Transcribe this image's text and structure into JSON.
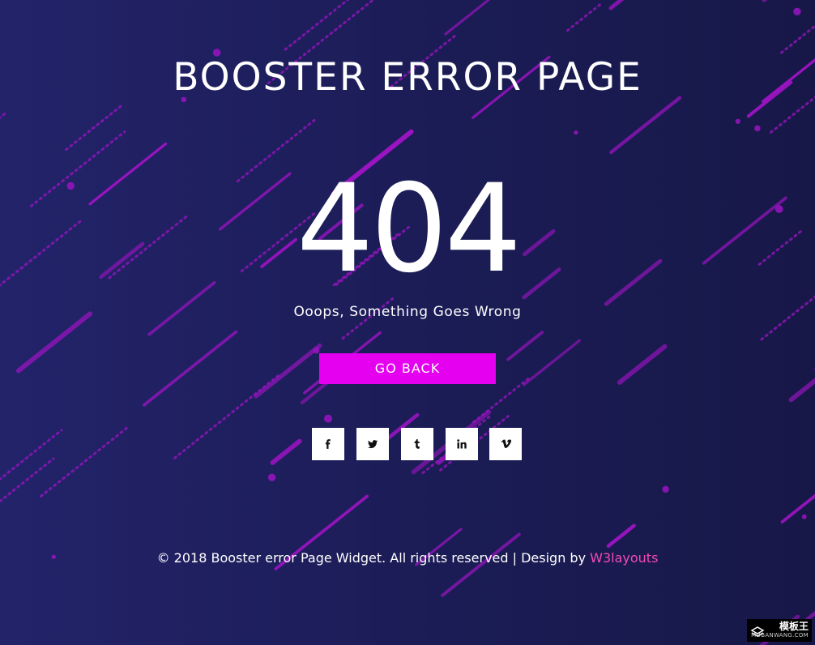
{
  "page": {
    "title": "BOOSTER ERROR PAGE",
    "error_code": "404",
    "message": "Ooops, Something Goes Wrong",
    "go_back_label": "GO BACK"
  },
  "social": [
    {
      "label": "f",
      "icon": "facebook-icon"
    },
    {
      "label": "twitter",
      "icon": "twitter-icon"
    },
    {
      "label": "t",
      "icon": "tumblr-icon"
    },
    {
      "label": "in",
      "icon": "linkedin-icon"
    },
    {
      "label": "v",
      "icon": "vimeo-icon"
    }
  ],
  "footer": {
    "text": "© 2018 Booster error Page Widget. All rights reserved | Design by ",
    "link_label": "W3layouts"
  },
  "watermark": {
    "top": "模板王",
    "bottom": "MOBANWANG.COM"
  },
  "colors": {
    "background_left": "#23236a",
    "background_right": "#171848",
    "streak": "#9b14c2",
    "button": "#e600f0",
    "link": "#f14bb5"
  }
}
